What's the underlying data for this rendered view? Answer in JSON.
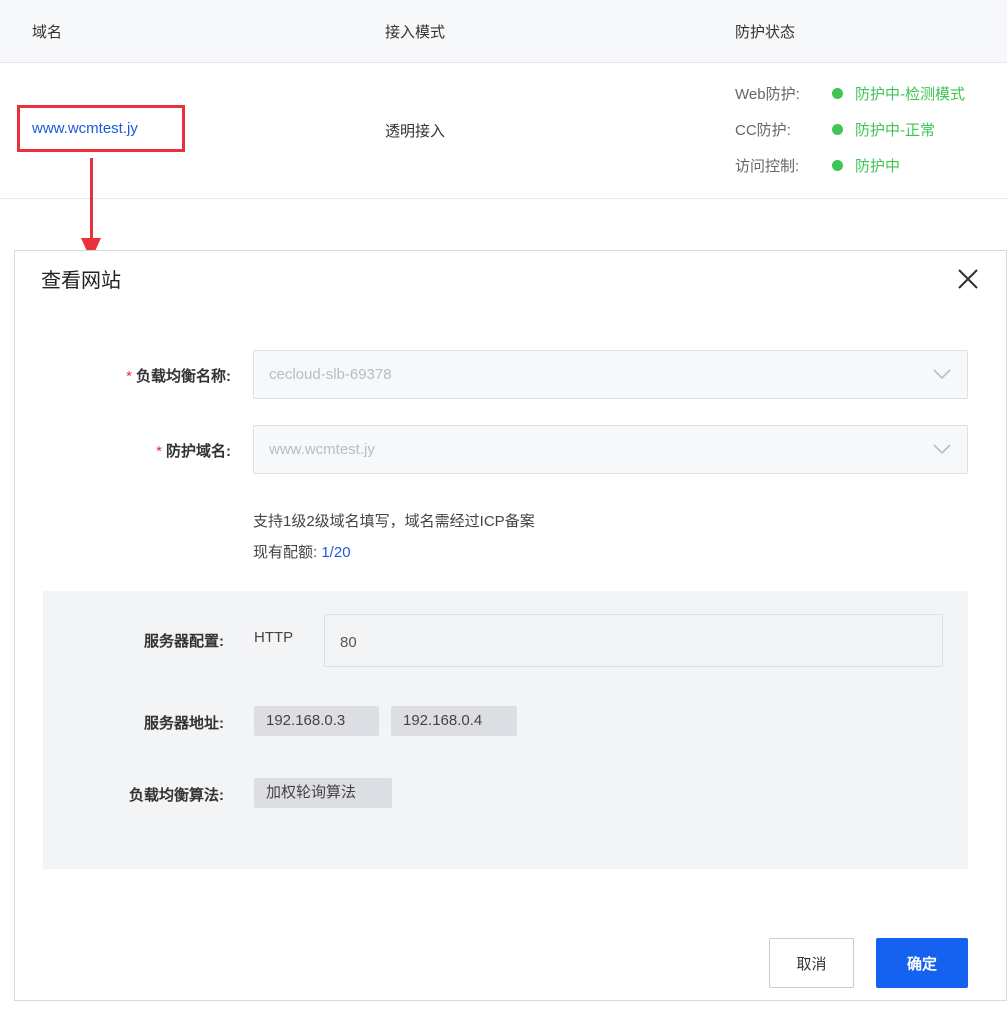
{
  "table": {
    "headers": {
      "domain": "域名",
      "mode": "接入模式",
      "status": "防护状态"
    },
    "row": {
      "domain": "www.wcmtest.jy",
      "mode": "透明接入",
      "statuses": [
        {
          "label": "Web防护:",
          "value": "防护中-检测模式"
        },
        {
          "label": "CC防护:",
          "value": "防护中-正常"
        },
        {
          "label": "访问控制:",
          "value": "防护中"
        }
      ]
    }
  },
  "dialog": {
    "title": "查看网站",
    "fields": {
      "slb_label": "负载均衡名称:",
      "slb_value": "cecloud-slb-69378",
      "domain_label": "防护域名:",
      "domain_value": "www.wcmtest.jy",
      "required_mark": "*"
    },
    "help": {
      "line1": "支持1级2级域名填写，域名需经过ICP备案",
      "quota_label": "现有配额:",
      "quota_value": "1/20"
    },
    "server": {
      "config_label": "服务器配置:",
      "protocol": "HTTP",
      "port": "80",
      "address_label": "服务器地址:",
      "addresses": [
        "192.168.0.3",
        "192.168.0.4"
      ],
      "algorithm_label": "负载均衡算法:",
      "algorithm": "加权轮询算法"
    },
    "buttons": {
      "cancel": "取消",
      "ok": "确定"
    }
  },
  "colors": {
    "accent": "#1662f0",
    "link": "#1e5bd8",
    "status_green": "#3ec552",
    "annotation_red": "#e8313a"
  },
  "icons": [
    "close-icon",
    "chevron-down-icon",
    "status-dot-icon"
  ]
}
